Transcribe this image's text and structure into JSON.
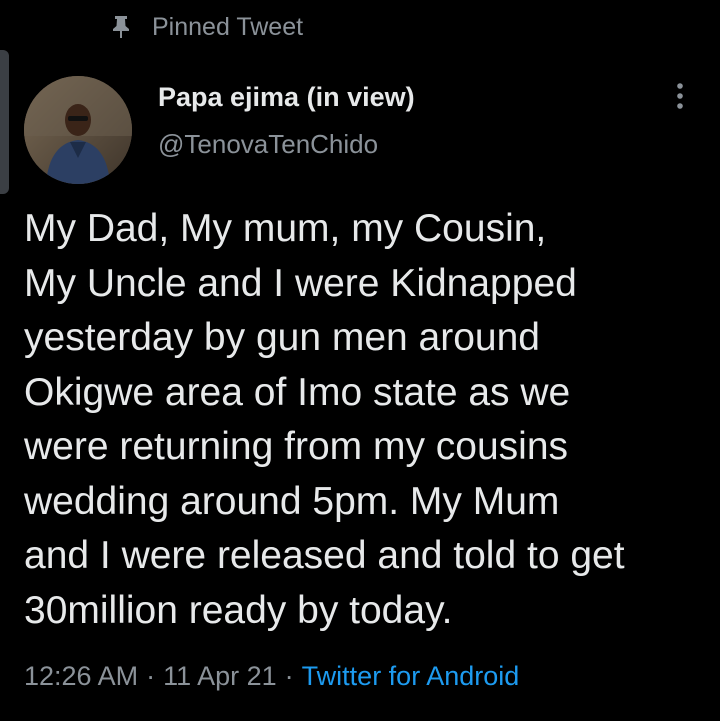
{
  "colors": {
    "background": "#000000",
    "text_primary": "#e7e9ea",
    "text_secondary": "#8b9299",
    "link": "#1d9bf0"
  },
  "pinned": {
    "icon": "pin-icon",
    "label": "Pinned Tweet"
  },
  "author": {
    "display_name": "Papa ejima (in view)",
    "handle": "@TenovaTenChido",
    "avatar": "avatar"
  },
  "menu": {
    "icon": "more-vertical-icon"
  },
  "tweet": {
    "text": "My Dad, My mum, my Cousin,\nMy Uncle and I were Kidnapped\nyesterday by gun men around\nOkigwe area of Imo state as we\nwere returning from my cousins\nwedding around 5pm. My Mum\nand I were released and told to get\n30million ready by today."
  },
  "meta": {
    "time": "12:26 AM",
    "separator": "·",
    "date": "11 Apr 21",
    "source": "Twitter for Android"
  }
}
